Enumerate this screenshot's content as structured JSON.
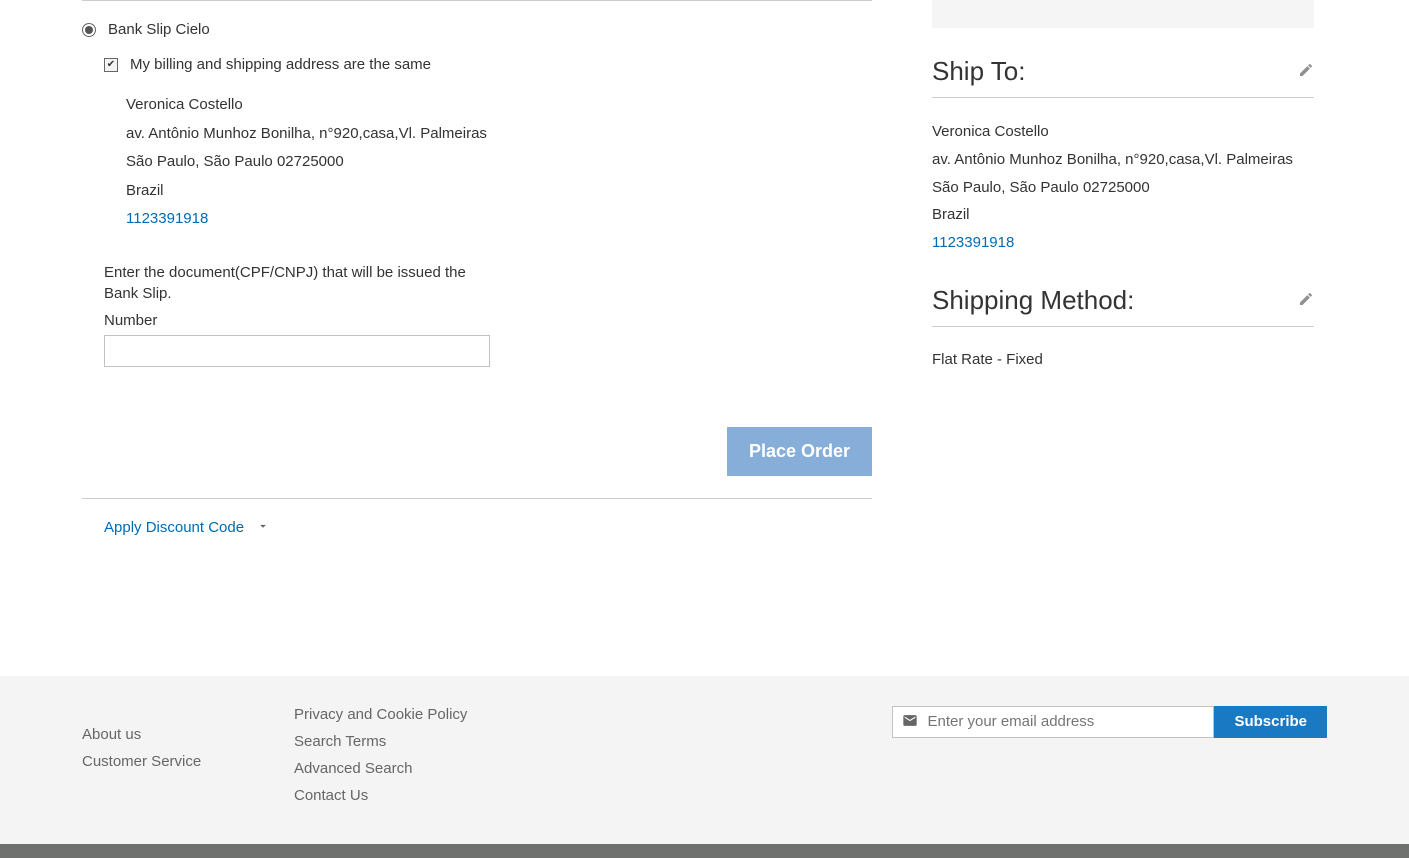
{
  "payment": {
    "method_label": "Bank Slip Cielo",
    "same_address_label": "My billing and shipping address are the same",
    "doc_instruction": "Enter the document(CPF/CNPJ) that will be issued the Bank Slip.",
    "number_label": "Number"
  },
  "billing_address": {
    "name": "Veronica Costello",
    "street": "av. Antônio Munhoz Bonilha, n°920,casa,Vl. Palmeiras",
    "city_region_postal": "São Paulo, São Paulo 02725000",
    "country": "Brazil",
    "phone": "1123391918"
  },
  "actions": {
    "place_order_label": "Place Order",
    "discount_label": "Apply Discount Code"
  },
  "sidebar": {
    "ship_to_title": "Ship To:",
    "shipping_method_title": "Shipping Method:",
    "shipping_method_value": "Flat Rate - Fixed"
  },
  "ship_to_address": {
    "name": "Veronica Costello",
    "street": "av. Antônio Munhoz Bonilha, n°920,casa,Vl. Palmeiras",
    "city_region_postal": "São Paulo, São Paulo 02725000",
    "country": "Brazil",
    "phone": "1123391918"
  },
  "footer": {
    "col1": {
      "about": "About us",
      "customer_service": "Customer Service"
    },
    "col2": {
      "privacy": "Privacy and Cookie Policy",
      "search_terms": "Search Terms",
      "advanced_search": "Advanced Search",
      "contact": "Contact Us"
    },
    "newsletter": {
      "placeholder": "Enter your email address",
      "subscribe_label": "Subscribe"
    }
  }
}
